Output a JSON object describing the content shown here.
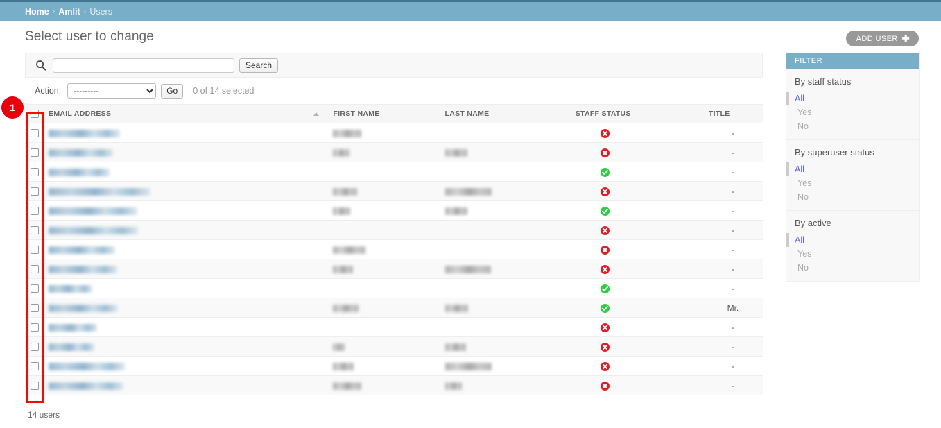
{
  "breadcrumbs": {
    "home": "Home",
    "app": "Amlit",
    "current": "Users",
    "separator": "›"
  },
  "header": {
    "page_title": "Select user to change",
    "add_button_label": "ADD USER",
    "add_button_plus": "✚"
  },
  "search": {
    "value": "",
    "placeholder": "",
    "submit_label": "Search",
    "icon": "search-icon"
  },
  "actions": {
    "label": "Action:",
    "selected_option": "---------",
    "options": [
      "---------"
    ],
    "go_label": "Go",
    "counter": "0 of 14 selected"
  },
  "table": {
    "columns": [
      {
        "key": "select",
        "label": ""
      },
      {
        "key": "email",
        "label": "EMAIL ADDRESS",
        "sorted": "asc"
      },
      {
        "key": "first_name",
        "label": "FIRST NAME"
      },
      {
        "key": "last_name",
        "label": "LAST NAME"
      },
      {
        "key": "staff_status",
        "label": "STAFF STATUS"
      },
      {
        "key": "title",
        "label": "TITLE"
      }
    ],
    "rows": [
      {
        "email_redacted_width": 103,
        "first_redacted_width": 41,
        "last_redacted_width": 0,
        "staff_status": "no",
        "title": "-"
      },
      {
        "email_redacted_width": 93,
        "first_redacted_width": 24,
        "last_redacted_width": 32,
        "staff_status": "no",
        "title": "-"
      },
      {
        "email_redacted_width": 88,
        "first_redacted_width": 0,
        "last_redacted_width": 0,
        "staff_status": "yes",
        "title": "-"
      },
      {
        "email_redacted_width": 147,
        "first_redacted_width": 35,
        "last_redacted_width": 67,
        "staff_status": "no",
        "title": "-"
      },
      {
        "email_redacted_width": 128,
        "first_redacted_width": 25,
        "last_redacted_width": 32,
        "staff_status": "yes",
        "title": "-"
      },
      {
        "email_redacted_width": 129,
        "first_redacted_width": 0,
        "last_redacted_width": 0,
        "staff_status": "no",
        "title": "-"
      },
      {
        "email_redacted_width": 96,
        "first_redacted_width": 47,
        "last_redacted_width": 0,
        "staff_status": "no",
        "title": "-"
      },
      {
        "email_redacted_width": 99,
        "first_redacted_width": 29,
        "last_redacted_width": 66,
        "staff_status": "no",
        "title": "-"
      },
      {
        "email_redacted_width": 63,
        "first_redacted_width": 0,
        "last_redacted_width": 0,
        "staff_status": "yes",
        "title": "-"
      },
      {
        "email_redacted_width": 100,
        "first_redacted_width": 37,
        "last_redacted_width": 33,
        "staff_status": "yes",
        "title": "Mr."
      },
      {
        "email_redacted_width": 70,
        "first_redacted_width": 0,
        "last_redacted_width": 0,
        "staff_status": "no",
        "title": "-"
      },
      {
        "email_redacted_width": 66,
        "first_redacted_width": 17,
        "last_redacted_width": 30,
        "staff_status": "no",
        "title": "-"
      },
      {
        "email_redacted_width": 110,
        "first_redacted_width": 30,
        "last_redacted_width": 67,
        "staff_status": "no",
        "title": "-"
      },
      {
        "email_redacted_width": 108,
        "first_redacted_width": 41,
        "last_redacted_width": 24,
        "staff_status": "no",
        "title": "-"
      }
    ],
    "result_count": "14 users"
  },
  "filter": {
    "header": "FILTER",
    "groups": [
      {
        "title": "By staff status",
        "choices": [
          "All",
          "Yes",
          "No"
        ],
        "selected": "All"
      },
      {
        "title": "By superuser status",
        "choices": [
          "All",
          "Yes",
          "No"
        ],
        "selected": "All"
      },
      {
        "title": "By active",
        "choices": [
          "All",
          "Yes",
          "No"
        ],
        "selected": "All"
      }
    ]
  },
  "annotation": {
    "badge_number": "1"
  },
  "colors": {
    "brand_header": "#79aec8",
    "brand_border": "#417690",
    "status_yes": "#2ecc40",
    "status_no": "#e01b24",
    "annotation_red": "#f20c00",
    "link_blue": "#5b6ad0"
  }
}
